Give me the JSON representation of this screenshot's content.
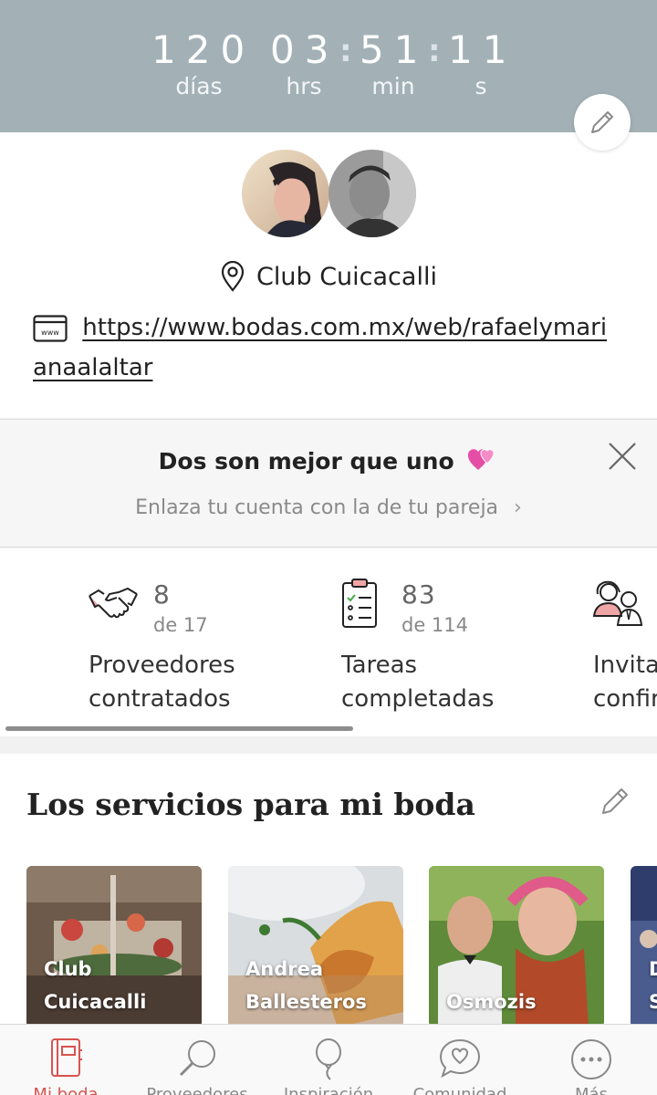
{
  "countdown": {
    "days": "120",
    "days_label": "días",
    "hours": "03",
    "hours_label": "hrs",
    "minutes": "51",
    "minutes_label": "min",
    "seconds": "11",
    "seconds_label": "s"
  },
  "profile": {
    "venue": "Club Cuicacalli",
    "website": "https://www.bodas.com.mx/web/rafaelymari anaalaltar",
    "website_icon_text": "www"
  },
  "partner_banner": {
    "title": "Dos son mejor que uno",
    "subtitle": "Enlaza tu cuenta con la de tu pareja"
  },
  "stats": [
    {
      "value": "8",
      "total": "de 17",
      "label_line1": "Proveedores",
      "label_line2": "contratados",
      "icon": "handshake-icon"
    },
    {
      "value": "83",
      "total": "de 114",
      "label_line1": "Tareas",
      "label_line2": "completadas",
      "icon": "checklist-icon"
    },
    {
      "value": "",
      "total": "",
      "label_line1": "Invita",
      "label_line2": "confir",
      "icon": "guests-icon"
    }
  ],
  "services": {
    "title": "Los servicios para mi boda",
    "cards": [
      {
        "line1": "Club",
        "line2": "Cuicacalli"
      },
      {
        "line1": "Andrea",
        "line2": "Ballesteros"
      },
      {
        "line1": "",
        "line2": "Osmozis"
      },
      {
        "line1": "D",
        "line2": "S"
      }
    ]
  },
  "tabbar": {
    "tabs": [
      {
        "label": "Mi boda",
        "icon": "notebook-icon",
        "active": true
      },
      {
        "label": "Proveedores",
        "icon": "magnifier-icon",
        "active": false
      },
      {
        "label": "Inspiración",
        "icon": "balloon-icon",
        "active": false
      },
      {
        "label": "Comunidad",
        "icon": "chat-heart-icon",
        "active": false
      },
      {
        "label": "Más",
        "icon": "more-icon",
        "active": false
      }
    ]
  },
  "colors": {
    "header": "#a3b1b7",
    "accent": "#d9534f"
  }
}
